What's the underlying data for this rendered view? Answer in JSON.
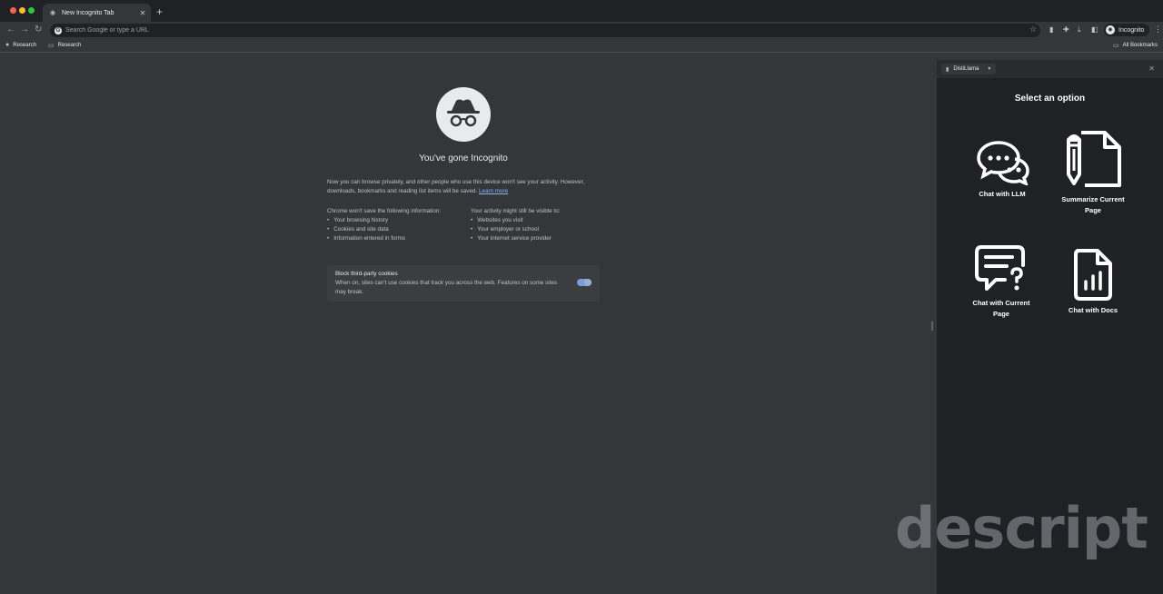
{
  "browser": {
    "tab_title": "New Incognito Tab",
    "tab_close": "✕",
    "new_tab": "+",
    "omnibox_placeholder": "Search Google or type a URL",
    "profile_label": "Incognito"
  },
  "bookmarks": {
    "items": [
      {
        "label": "Research",
        "icon": "github-icon"
      },
      {
        "label": "Research",
        "icon": "folder-icon"
      }
    ],
    "all_bookmarks": "All Bookmarks"
  },
  "incognito": {
    "heading": "You've gone Incognito",
    "intro_text": "Now you can browse privately, and other people who use this device won't see your activity. However, downloads, bookmarks and reading list items will be saved.",
    "learn_more": "Learn more",
    "left_column": {
      "title": "Chrome won't save the following information:",
      "items": [
        "Your browsing history",
        "Cookies and site data",
        "Information entered in forms"
      ]
    },
    "right_column": {
      "title": "Your activity might still be visible to:",
      "items": [
        "Websites you visit",
        "Your employer or school",
        "Your internet service provider"
      ]
    },
    "cookies": {
      "title": "Block third-party cookies",
      "description": "When on, sites can't use cookies that track you across the web. Features on some sites may break.",
      "enabled": true
    }
  },
  "side_panel": {
    "selector_label": "DistiLlama",
    "title": "Select an option",
    "options": [
      {
        "label": "Chat with LLM",
        "icon": "chat-bubbles-icon"
      },
      {
        "label": "Summarize Current Page",
        "icon": "document-pencil-icon"
      },
      {
        "label": "Chat with Current Page",
        "icon": "message-question-icon"
      },
      {
        "label": "Chat with Docs",
        "icon": "document-chart-icon"
      }
    ]
  },
  "watermark": "descript",
  "colors": {
    "page_bg": "#35363a",
    "panel_bg": "#202124",
    "link": "#8ab4f8",
    "toggle": "#8ab4f8"
  }
}
